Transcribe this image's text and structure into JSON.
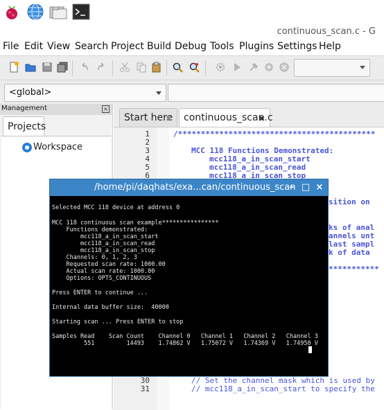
{
  "desktop": {
    "icons": [
      "raspberry-icon",
      "globe-icon",
      "folders-icon",
      "terminal-icon"
    ]
  },
  "geany": {
    "title": "continuous_scan.c - G",
    "menu": [
      "File",
      "Edit",
      "View",
      "Search",
      "Project",
      "Build",
      "Debug",
      "Tools",
      "Plugins",
      "Settings",
      "Help"
    ],
    "symbol_combo": "<global>",
    "sidebar": {
      "header": "Management",
      "tab": "Projects",
      "workspace": "Workspace"
    },
    "tabs": [
      {
        "label": "Start here"
      },
      {
        "label": "continuous_scan.c"
      }
    ],
    "line_numbers": [
      "1",
      "2",
      "3",
      "4",
      "5",
      "6",
      "30",
      "31"
    ],
    "code": {
      "l1": "/*******************************************",
      "l3": "MCC 118 Functions Demonstrated:",
      "l4": "mcc118_a_in_scan_start",
      "l5": "mcc118_a_in_scan_read",
      "l6": "mcc118_a_in_scan_stop",
      "p1": "sition on",
      "p2": "ks of anal",
      "p3": "annels unt",
      "p4": "last sampl",
      "p5": "k of data",
      "p6": "***********",
      "l30": "// Set the channel mask which is used by",
      "l31": "// mcc118_a_in_scan_start to specify the"
    }
  },
  "terminal": {
    "title": "/home/pi/daqhats/exa...can/continuous_scan",
    "lines": [
      "Selected MCC 118 device at address 0",
      "",
      "MCC 118 continuous scan example****************",
      "    Functions demonstrated:",
      "        mcc118_a_in_scan_start",
      "        mcc118_a_in_scan_read",
      "        mcc118_a_in_scan_stop",
      "    Channels: 0, 1, 2, 3",
      "    Requested scan rate: 1000.00",
      "    Actual scan rate: 1000.00",
      "    Options: OPTS_CONTINUOUS",
      "",
      "Press ENTER to continue ...",
      "",
      "Internal data buffer size:  40000",
      "",
      "Starting scan ... Press ENTER to stop",
      "",
      "Samples Read    Scan Count    Channel 0   Channel 1   Channel 2   Channel 3",
      "         551         14493    1.74862 V   1.75072 V   1.74369 V   1.74950 V"
    ]
  }
}
